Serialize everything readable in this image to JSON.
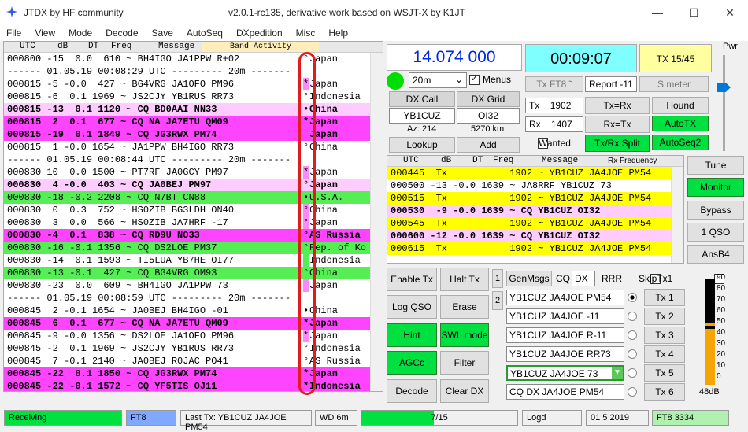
{
  "window": {
    "title": "JTDX  by HF community",
    "version": "v2.0.1-rc135, derivative work based on WSJT-X by K1JT"
  },
  "menu": [
    "File",
    "View",
    "Mode",
    "Decode",
    "Save",
    "AutoSeq",
    "DXpedition",
    "Misc",
    "Help"
  ],
  "band_activity": {
    "caption": "Band Activity",
    "columns": [
      "UTC",
      "dB",
      "DT",
      "Freq",
      "Message"
    ],
    "rows": [
      {
        "text": "000800 -15  0.0  610 ~ BH4IGO JA1PPW R+02",
        "country": "Japan",
        "bg": "#ffffff",
        "bold": false,
        "mark": "°",
        "mark_color": ""
      },
      {
        "text": "------ 01.05.19 00:08:29 UTC --------- 20m -------",
        "country": "",
        "bg": "#ffffff",
        "bold": false,
        "mark": "",
        "mark_color": ""
      },
      {
        "text": "000815 -5 -0.0  427 ~ BG4VRG JA1OFO PM96",
        "country": "Japan",
        "bg": "#ffffff",
        "bold": false,
        "mark": "*",
        "mark_color": "#ff88ff"
      },
      {
        "text": "000815 -6  0.1 1969 ~ JS2CJY YB1RUS RR73",
        "country": "Indonesia",
        "bg": "#ffffff",
        "bold": false,
        "mark": "°",
        "mark_color": ""
      },
      {
        "text": "000815 -13  0.1 1120 ~ CQ BD0AAI NN33",
        "country": "China",
        "bg": "#ffccff",
        "bold": true,
        "mark": "•",
        "mark_color": ""
      },
      {
        "text": "000815  2  0.1  677 ~ CQ NA JA7ETU QM09",
        "country": "Japan",
        "bg": "#ff44ff",
        "bold": true,
        "mark": "*",
        "mark_color": ""
      },
      {
        "text": "000815 -19  0.1 1849 ~ CQ JG3RWX PM74",
        "country": "Japan",
        "bg": "#ff44ff",
        "bold": true,
        "mark": "",
        "mark_color": ""
      },
      {
        "text": "000815  1 -0.0 1654 ~ JA1PPW BH4IGO RR73",
        "country": "China",
        "bg": "#ffffff",
        "bold": false,
        "mark": "°",
        "mark_color": ""
      },
      {
        "text": "------ 01.05.19 00:08:44 UTC --------- 20m -------",
        "country": "",
        "bg": "#ffffff",
        "bold": false,
        "mark": "",
        "mark_color": ""
      },
      {
        "text": "000830 10  0.0 1500 ~ PT7RF JA0GCY PM97",
        "country": "Japan",
        "bg": "#ffffff",
        "bold": false,
        "mark": "*",
        "mark_color": "#ff88ff"
      },
      {
        "text": "000830  4 -0.0  403 ~ CQ JA0BEJ PM97",
        "country": "Japan",
        "bg": "#ffccff",
        "bold": true,
        "mark": "°",
        "mark_color": ""
      },
      {
        "text": "000830 -18 -0.2 2208 ~ CQ N7BT CN88",
        "country": "U.S.A.",
        "bg": "#55ee55",
        "bold": false,
        "mark": "•",
        "mark_color": ""
      },
      {
        "text": "000830  0  0.3  752 ~ HS0ZIB BG3LDH ON40",
        "country": "China",
        "bg": "#ffffff",
        "bold": false,
        "mark": "°",
        "mark_color": "#ff88ff"
      },
      {
        "text": "000830  3  0.0  566 ~ HS0ZIB JA7HRF -17",
        "country": "Japan",
        "bg": "#ffffff",
        "bold": false,
        "mark": "°",
        "mark_color": "#ff88ff"
      },
      {
        "text": "000830 -4  0.1  838 ~ CQ RD9U NO33",
        "country": "AS Russia",
        "bg": "#ff44ff",
        "bold": true,
        "mark": "°",
        "mark_color": ""
      },
      {
        "text": "000830 -16 -0.1 1356 ~ CQ DS2LOE PM37",
        "country": "Rep. of Ko",
        "bg": "#55ee55",
        "bold": false,
        "mark": "°",
        "mark_color": ""
      },
      {
        "text": "000830 -14  0.1 1593 ~ TI5LUA YB7HE OI77",
        "country": "Indonesia",
        "bg": "#ffffff",
        "bold": false,
        "mark": "",
        "mark_color": "#55ee55"
      },
      {
        "text": "000830 -13 -0.1  427 ~ CQ BG4VRG OM93",
        "country": "China",
        "bg": "#55ee55",
        "bold": false,
        "mark": "°",
        "mark_color": ""
      },
      {
        "text": "000830 -23  0.0  609 ~ BH4IGO JA1PPW 73",
        "country": "Japan",
        "bg": "#ffffff",
        "bold": false,
        "mark": "",
        "mark_color": "#ff88ff"
      },
      {
        "text": "------ 01.05.19 00:08:59 UTC --------- 20m -------",
        "country": "",
        "bg": "#ffffff",
        "bold": false,
        "mark": "",
        "mark_color": ""
      },
      {
        "text": "000845  2 -0.1 1654 ~ JA0BEJ BH4IGO -01",
        "country": "China",
        "bg": "#ffffff",
        "bold": false,
        "mark": "•",
        "mark_color": ""
      },
      {
        "text": "000845  6  0.1  677 ~ CQ NA JA7ETU QM09",
        "country": "Japan",
        "bg": "#ff44ff",
        "bold": true,
        "mark": "*",
        "mark_color": ""
      },
      {
        "text": "000845 -9 -0.0 1356 ~ DS2LOE JA1OFO PM96",
        "country": "Japan",
        "bg": "#ffffff",
        "bold": false,
        "mark": "*",
        "mark_color": "#ff88ff"
      },
      {
        "text": "000845 -2  0.1 1969 ~ JS2CJY YB1RUS RR73",
        "country": "Indonesia",
        "bg": "#ffffff",
        "bold": false,
        "mark": "°",
        "mark_color": ""
      },
      {
        "text": "000845  7 -0.1 2140 ~ JA0BEJ R0JAC PO41",
        "country": "AS Russia",
        "bg": "#ffffff",
        "bold": false,
        "mark": "°",
        "mark_color": ""
      },
      {
        "text": "000845 -22  0.1 1850 ~ CQ JG3RWX PM74",
        "country": "Japan",
        "bg": "#ff44ff",
        "bold": true,
        "mark": "*",
        "mark_color": ""
      },
      {
        "text": "000845 -22 -0.1 1572 ~ CQ YF5TIS OJ11",
        "country": "Indonesia",
        "bg": "#ff44ff",
        "bold": true,
        "mark": "*",
        "mark_color": ""
      }
    ]
  },
  "frequency": "14.074 000",
  "clock": "00:09:07",
  "tx_period": "TX 15/45",
  "pwr_label": "Pwr",
  "band": "20m",
  "menus_label": "Menus",
  "dx": {
    "call_label": "DX Call",
    "grid_label": "DX Grid",
    "call": "YB1CUZ",
    "grid": "OI32",
    "az": "Az: 214",
    "dist": "5270 km",
    "lookup": "Lookup",
    "add": "Add"
  },
  "controls": {
    "tx_ft8": "Tx FT8 ˜",
    "report": "Report -11",
    "smeter": "S meter",
    "tx_label": "Tx",
    "tx_value": "1902",
    "rx_label": "Rx",
    "rx_value": "1407",
    "tx_eq_rx": "Tx=Rx",
    "hound": "Hound",
    "rx_eq_tx": "Rx=Tx",
    "auto_tx": "AutoTX",
    "wanted": "Wanted",
    "tx_rx_split": "Tx/Rx Split",
    "autoseq2": "AutoSeq2"
  },
  "rx_frequency": {
    "caption": "Rx Frequency",
    "columns": [
      "UTC",
      "dB",
      "DT",
      "Freq",
      "Message"
    ],
    "rows": [
      {
        "text": "000445  Tx           1902 ~ YB1CUZ JA4JOE PM54",
        "bg": "#ffff00",
        "bold": false
      },
      {
        "text": "000500 -13 -0.0 1639 ~ JA8RRF YB1CUZ 73",
        "bg": "#ffffff",
        "bold": false
      },
      {
        "text": "000515  Tx           1902 ~ YB1CUZ JA4JOE PM54",
        "bg": "#ffff00",
        "bold": false
      },
      {
        "text": "000530  -9 -0.0 1639 ~ CQ YB1CUZ OI32",
        "bg": "#ffccff",
        "bold": true
      },
      {
        "text": "000545  Tx           1902 ~ YB1CUZ JA4JOE PM54",
        "bg": "#ffff00",
        "bold": false
      },
      {
        "text": "000600 -12 -0.0 1639 ~ CQ YB1CUZ OI32",
        "bg": "#ffccff",
        "bold": true
      },
      {
        "text": "000615  Tx           1902 ~ YB1CUZ JA4JOE PM54",
        "bg": "#ffff00",
        "bold": false
      }
    ]
  },
  "side_buttons": {
    "tune": "Tune",
    "monitor": "Monitor",
    "bypass": "Bypass",
    "one_qso": "1 QSO",
    "ansb4": "AnsB4"
  },
  "lower_buttons": {
    "enable_tx": "Enable Tx",
    "halt_tx": "Halt Tx",
    "log_qso": "Log QSO",
    "erase": "Erase",
    "hint": "Hint",
    "swl_mode": "SWL mode",
    "agcc": "AGCc",
    "filter": "Filter",
    "decode": "Decode",
    "clear_dx": "Clear DX"
  },
  "messages": {
    "tab1": "1",
    "tab2": "2",
    "genmsgs": "GenMsgs",
    "cq_label": "CQ",
    "cq_value": "DX",
    "rrr_label": "RRR",
    "skiptx1_label": "SkipTx1",
    "tx": [
      {
        "msg": "YB1CUZ JA4JOE PM54",
        "button": "Tx 1"
      },
      {
        "msg": "YB1CUZ JA4JOE -11",
        "button": "Tx 2"
      },
      {
        "msg": "YB1CUZ JA4JOE R-11",
        "button": "Tx 3"
      },
      {
        "msg": "YB1CUZ JA4JOE RR73",
        "button": "Tx 4"
      },
      {
        "msg": "YB1CUZ JA4JOE 73",
        "button": "Tx 5"
      },
      {
        "msg": "CQ DX JA4JOE PM54",
        "button": "Tx 6"
      }
    ]
  },
  "meter": {
    "scale": [
      "90",
      "80",
      "70",
      "60",
      "50",
      "40",
      "30",
      "20",
      "10",
      "0"
    ],
    "db": "48dB",
    "level_db": 48
  },
  "status_bar": {
    "receiving": "Receiving",
    "mode": "FT8",
    "last_tx": "Last Tx: YB1CUZ JA4JOE PM54",
    "wd": "WD 6m",
    "progress": "7/15",
    "progress_fraction": 0.467,
    "logd": "Logd",
    "date": "01 5 2019",
    "ft8_info": "FT8  3334"
  },
  "colors": {
    "cq_pink": "#ff44ff",
    "new_dxcc_green": "#55ee55",
    "tx_yellow": "#ffff00",
    "freq_blue": "#0026e6",
    "clock_cyan": "#80ffff",
    "button_green": "#00e040",
    "annotation_red": "#e21c1c"
  }
}
